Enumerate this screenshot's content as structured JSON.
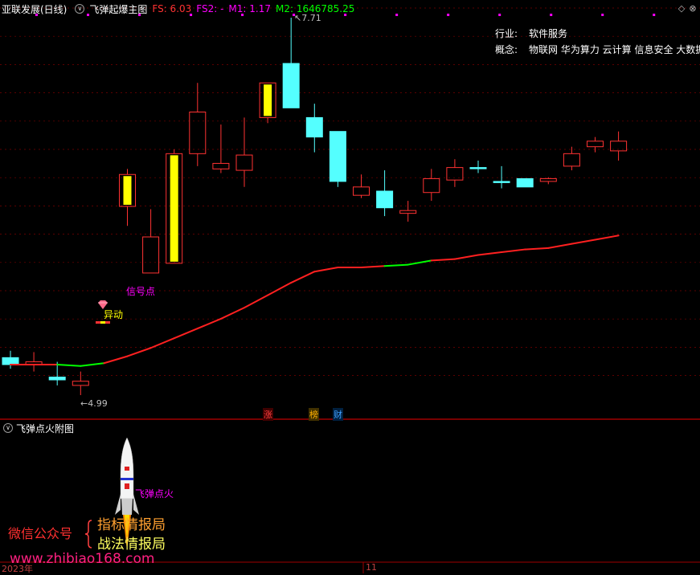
{
  "header": {
    "stock": "亚联发展(日线)",
    "indicator": "飞弹起爆主图",
    "fs": "FS: 6.03",
    "fs2": "FS2: -",
    "m1": "M1: 1.17",
    "m2": "M2: 1646785.25"
  },
  "info": {
    "industry_label": "行业:",
    "industry_value": "软件服务",
    "concept_label": "概念:",
    "concept_value": "物联网 华为算力 云计算 信息安全 大数据"
  },
  "annotations": {
    "high": "7.71",
    "low": "4.99",
    "signal": "信号点",
    "anomaly": "异动",
    "tag_zhang": "涨",
    "tag_bang": "榜",
    "tag_cai": "财"
  },
  "subchart": {
    "title": "飞弹点火附图",
    "ignite_label": "飞弹点火"
  },
  "promo": {
    "wechat": "微信公众号",
    "line1": "指标情报局",
    "line2": "战法情报局",
    "site": "www.zhibiao168.com"
  },
  "axis": {
    "year": "2023年",
    "month": "11"
  },
  "colors": {
    "up": "#ff3232",
    "down": "#54ffff",
    "signal": "#ffff00",
    "ma": "#ff2020",
    "ma_green": "#00ff00",
    "grid": "#7a0000",
    "magenta": "#ff00ff"
  },
  "candles": [
    {
      "o": 5.26,
      "c": 5.21,
      "h": 5.31,
      "l": 5.18,
      "type": "down"
    },
    {
      "o": 5.23,
      "c": 5.21,
      "h": 5.3,
      "l": 5.16,
      "type": "up"
    },
    {
      "o": 5.12,
      "c": 5.1,
      "h": 5.23,
      "l": 5.06,
      "type": "down"
    },
    {
      "o": 5.06,
      "c": 5.09,
      "h": 5.16,
      "l": 4.99,
      "type": "up"
    },
    {
      "o": 0,
      "c": 0,
      "h": 0,
      "l": 0,
      "type": "none"
    },
    {
      "o": 6.35,
      "c": 6.58,
      "h": 6.62,
      "l": 6.21,
      "type": "signal"
    },
    {
      "o": 5.87,
      "c": 6.13,
      "h": 6.33,
      "l": 5.87,
      "type": "up"
    },
    {
      "o": 5.94,
      "c": 6.73,
      "h": 6.76,
      "l": 5.94,
      "type": "signal"
    },
    {
      "o": 6.73,
      "c": 7.03,
      "h": 7.24,
      "l": 6.64,
      "type": "up"
    },
    {
      "o": 6.62,
      "c": 6.66,
      "h": 6.94,
      "l": 6.59,
      "type": "up"
    },
    {
      "o": 6.61,
      "c": 6.72,
      "h": 6.99,
      "l": 6.49,
      "type": "up"
    },
    {
      "o": 6.99,
      "c": 7.24,
      "h": 7.24,
      "l": 6.95,
      "type": "signal"
    },
    {
      "o": 7.38,
      "c": 7.06,
      "h": 7.71,
      "l": 7.06,
      "type": "down"
    },
    {
      "o": 6.99,
      "c": 6.85,
      "h": 7.09,
      "l": 6.74,
      "type": "down"
    },
    {
      "o": 6.89,
      "c": 6.53,
      "h": 6.89,
      "l": 6.49,
      "type": "down"
    },
    {
      "o": 6.43,
      "c": 6.49,
      "h": 6.58,
      "l": 6.41,
      "type": "up"
    },
    {
      "o": 6.46,
      "c": 6.34,
      "h": 6.61,
      "l": 6.28,
      "type": "down"
    },
    {
      "o": 6.3,
      "c": 6.32,
      "h": 6.39,
      "l": 6.24,
      "type": "up"
    },
    {
      "o": 6.45,
      "c": 6.55,
      "h": 6.62,
      "l": 6.39,
      "type": "up"
    },
    {
      "o": 6.54,
      "c": 6.63,
      "h": 6.69,
      "l": 6.49,
      "type": "up"
    },
    {
      "o": 6.63,
      "c": 6.63,
      "h": 6.68,
      "l": 6.59,
      "type": "down"
    },
    {
      "o": 6.53,
      "c": 6.53,
      "h": 6.64,
      "l": 6.48,
      "type": "down"
    },
    {
      "o": 6.55,
      "c": 6.49,
      "h": 6.55,
      "l": 6.49,
      "type": "down"
    },
    {
      "o": 6.53,
      "c": 6.55,
      "h": 6.56,
      "l": 6.51,
      "type": "up"
    },
    {
      "o": 6.64,
      "c": 6.73,
      "h": 6.78,
      "l": 6.61,
      "type": "up"
    },
    {
      "o": 6.78,
      "c": 6.82,
      "h": 6.85,
      "l": 6.74,
      "type": "up"
    },
    {
      "o": 6.75,
      "c": 6.82,
      "h": 6.89,
      "l": 6.68,
      "type": "up"
    }
  ],
  "ma": [
    5.21,
    5.21,
    5.21,
    5.2,
    5.22,
    5.27,
    5.33,
    5.4,
    5.47,
    5.54,
    5.62,
    5.71,
    5.8,
    5.88,
    5.91,
    5.91,
    5.92,
    5.93,
    5.96,
    5.97,
    6.0,
    6.02,
    6.04,
    6.05,
    6.08,
    6.11,
    6.14
  ]
}
